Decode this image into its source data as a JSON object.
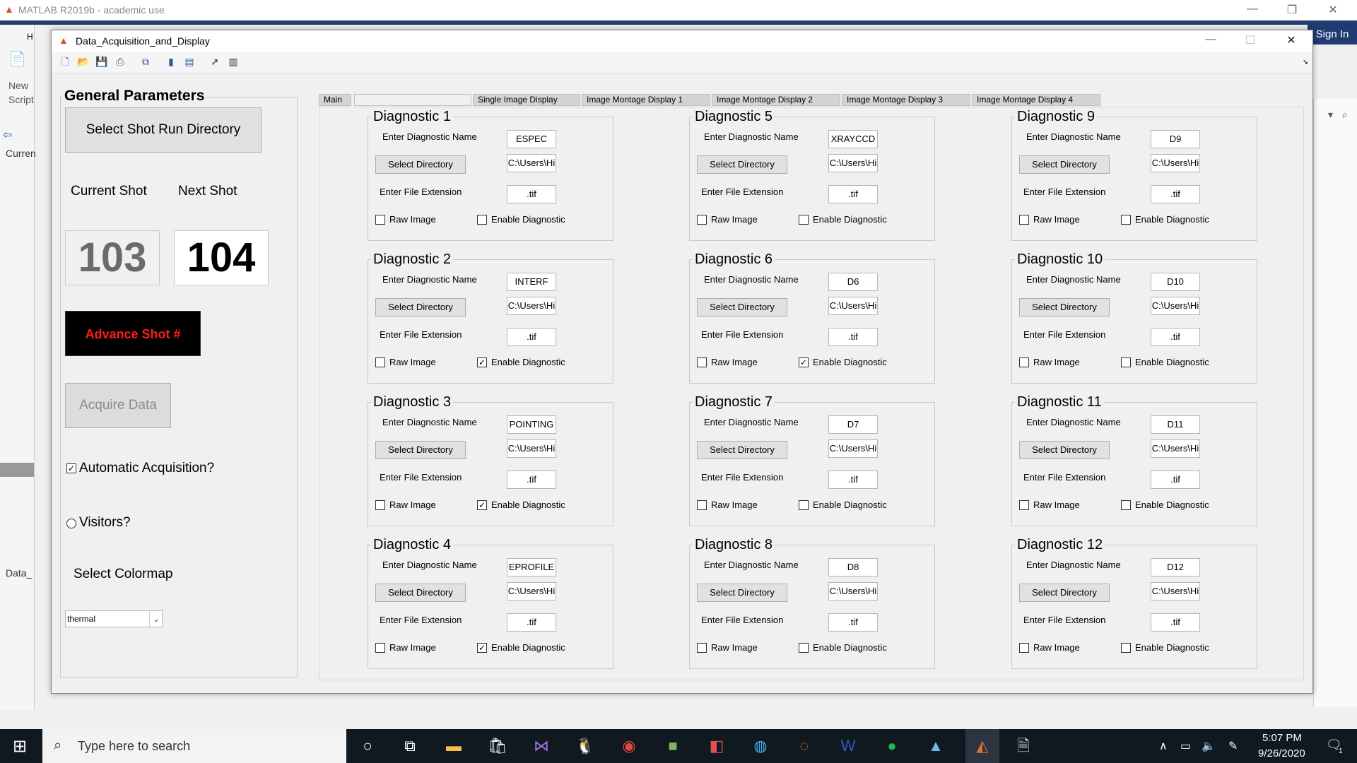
{
  "matlab": {
    "title": "MATLAB R2019b - academic use",
    "sign_in": "Sign In",
    "new_script": "New\nScript",
    "left_labels": [
      "Curren",
      "Data_"
    ],
    "side_letter": "H"
  },
  "figure": {
    "title": "Data_Acquisition_and_Display"
  },
  "general": {
    "title": "General Parameters",
    "select_shot_dir": "Select Shot Run Directory",
    "current_shot_label": "Current Shot",
    "next_shot_label": "Next Shot",
    "current_shot": "103",
    "next_shot": "104",
    "advance": "Advance Shot #",
    "acquire": "Acquire Data",
    "auto_acq": "Automatic Acquisition?",
    "auto_acq_checked": true,
    "visitors": "Visitors?",
    "visitors_checked": false,
    "colormap_label": "Select Colormap",
    "colormap_value": "thermal"
  },
  "tabs": [
    "Main",
    "",
    "Single Image Display",
    "Image Montage Display 1",
    "Image Montage Display 2",
    "Image Montage Display 3",
    "Image Montage Display 4"
  ],
  "diag_labels": {
    "enter_name": "Enter Diagnostic Name",
    "select_dir": "Select Directory",
    "file_ext": "Enter File Extension",
    "raw": "Raw Image",
    "enable": "Enable Diagnostic"
  },
  "diagnostics": [
    {
      "title": "Diagnostic 1",
      "name": "ESPEC",
      "dir": "C:\\Users\\Hi",
      "ext": ".tif",
      "raw": false,
      "enable": false
    },
    {
      "title": "Diagnostic 2",
      "name": "INTERF",
      "dir": "C:\\Users\\Hi",
      "ext": ".tif",
      "raw": false,
      "enable": true
    },
    {
      "title": "Diagnostic 3",
      "name": "POINTING",
      "dir": "C:\\Users\\Hi",
      "ext": ".tif",
      "raw": false,
      "enable": true
    },
    {
      "title": "Diagnostic 4",
      "name": "EPROFILE",
      "dir": "C:\\Users\\Hi",
      "ext": ".tif",
      "raw": false,
      "enable": true
    },
    {
      "title": "Diagnostic 5",
      "name": "XRAYCCD",
      "dir": "C:\\Users\\Hi",
      "ext": ".tif",
      "raw": false,
      "enable": false
    },
    {
      "title": "Diagnostic 6",
      "name": "D6",
      "dir": "C:\\Users\\Hi",
      "ext": ".tif",
      "raw": false,
      "enable": true
    },
    {
      "title": "Diagnostic 7",
      "name": "D7",
      "dir": "C:\\Users\\Hi",
      "ext": ".tif",
      "raw": false,
      "enable": false
    },
    {
      "title": "Diagnostic 8",
      "name": "D8",
      "dir": "C:\\Users\\Hi",
      "ext": ".tif",
      "raw": false,
      "enable": false
    },
    {
      "title": "Diagnostic 9",
      "name": "D9",
      "dir": "C:\\Users\\Hi",
      "ext": ".tif",
      "raw": false,
      "enable": false
    },
    {
      "title": "Diagnostic 10",
      "name": "D10",
      "dir": "C:\\Users\\Hi",
      "ext": ".tif",
      "raw": false,
      "enable": false
    },
    {
      "title": "Diagnostic 11",
      "name": "D11",
      "dir": "C:\\Users\\Hi",
      "ext": ".tif",
      "raw": false,
      "enable": false
    },
    {
      "title": "Diagnostic 12",
      "name": "D12",
      "dir": "C:\\Users\\Hi",
      "ext": ".tif",
      "raw": false,
      "enable": false
    }
  ],
  "taskbar": {
    "search_placeholder": "Type here to search",
    "time": "5:07 PM",
    "date": "9/26/2020",
    "notif_count": "1"
  },
  "colors": {
    "advance_bg": "#000000",
    "advance_text": "#ff1a1a",
    "matlab_blue": "#1f3b72"
  }
}
